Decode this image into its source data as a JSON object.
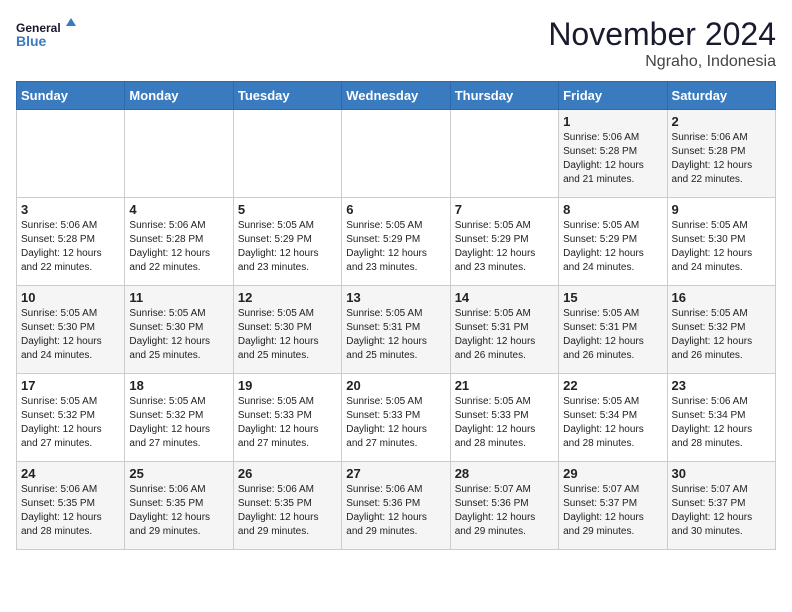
{
  "header": {
    "logo_line1": "General",
    "logo_line2": "Blue",
    "month": "November 2024",
    "location": "Ngraho, Indonesia"
  },
  "days_of_week": [
    "Sunday",
    "Monday",
    "Tuesday",
    "Wednesday",
    "Thursday",
    "Friday",
    "Saturday"
  ],
  "weeks": [
    [
      {
        "day": "",
        "info": ""
      },
      {
        "day": "",
        "info": ""
      },
      {
        "day": "",
        "info": ""
      },
      {
        "day": "",
        "info": ""
      },
      {
        "day": "",
        "info": ""
      },
      {
        "day": "1",
        "info": "Sunrise: 5:06 AM\nSunset: 5:28 PM\nDaylight: 12 hours\nand 21 minutes."
      },
      {
        "day": "2",
        "info": "Sunrise: 5:06 AM\nSunset: 5:28 PM\nDaylight: 12 hours\nand 22 minutes."
      }
    ],
    [
      {
        "day": "3",
        "info": "Sunrise: 5:06 AM\nSunset: 5:28 PM\nDaylight: 12 hours\nand 22 minutes."
      },
      {
        "day": "4",
        "info": "Sunrise: 5:06 AM\nSunset: 5:28 PM\nDaylight: 12 hours\nand 22 minutes."
      },
      {
        "day": "5",
        "info": "Sunrise: 5:05 AM\nSunset: 5:29 PM\nDaylight: 12 hours\nand 23 minutes."
      },
      {
        "day": "6",
        "info": "Sunrise: 5:05 AM\nSunset: 5:29 PM\nDaylight: 12 hours\nand 23 minutes."
      },
      {
        "day": "7",
        "info": "Sunrise: 5:05 AM\nSunset: 5:29 PM\nDaylight: 12 hours\nand 23 minutes."
      },
      {
        "day": "8",
        "info": "Sunrise: 5:05 AM\nSunset: 5:29 PM\nDaylight: 12 hours\nand 24 minutes."
      },
      {
        "day": "9",
        "info": "Sunrise: 5:05 AM\nSunset: 5:30 PM\nDaylight: 12 hours\nand 24 minutes."
      }
    ],
    [
      {
        "day": "10",
        "info": "Sunrise: 5:05 AM\nSunset: 5:30 PM\nDaylight: 12 hours\nand 24 minutes."
      },
      {
        "day": "11",
        "info": "Sunrise: 5:05 AM\nSunset: 5:30 PM\nDaylight: 12 hours\nand 25 minutes."
      },
      {
        "day": "12",
        "info": "Sunrise: 5:05 AM\nSunset: 5:30 PM\nDaylight: 12 hours\nand 25 minutes."
      },
      {
        "day": "13",
        "info": "Sunrise: 5:05 AM\nSunset: 5:31 PM\nDaylight: 12 hours\nand 25 minutes."
      },
      {
        "day": "14",
        "info": "Sunrise: 5:05 AM\nSunset: 5:31 PM\nDaylight: 12 hours\nand 26 minutes."
      },
      {
        "day": "15",
        "info": "Sunrise: 5:05 AM\nSunset: 5:31 PM\nDaylight: 12 hours\nand 26 minutes."
      },
      {
        "day": "16",
        "info": "Sunrise: 5:05 AM\nSunset: 5:32 PM\nDaylight: 12 hours\nand 26 minutes."
      }
    ],
    [
      {
        "day": "17",
        "info": "Sunrise: 5:05 AM\nSunset: 5:32 PM\nDaylight: 12 hours\nand 27 minutes."
      },
      {
        "day": "18",
        "info": "Sunrise: 5:05 AM\nSunset: 5:32 PM\nDaylight: 12 hours\nand 27 minutes."
      },
      {
        "day": "19",
        "info": "Sunrise: 5:05 AM\nSunset: 5:33 PM\nDaylight: 12 hours\nand 27 minutes."
      },
      {
        "day": "20",
        "info": "Sunrise: 5:05 AM\nSunset: 5:33 PM\nDaylight: 12 hours\nand 27 minutes."
      },
      {
        "day": "21",
        "info": "Sunrise: 5:05 AM\nSunset: 5:33 PM\nDaylight: 12 hours\nand 28 minutes."
      },
      {
        "day": "22",
        "info": "Sunrise: 5:05 AM\nSunset: 5:34 PM\nDaylight: 12 hours\nand 28 minutes."
      },
      {
        "day": "23",
        "info": "Sunrise: 5:06 AM\nSunset: 5:34 PM\nDaylight: 12 hours\nand 28 minutes."
      }
    ],
    [
      {
        "day": "24",
        "info": "Sunrise: 5:06 AM\nSunset: 5:35 PM\nDaylight: 12 hours\nand 28 minutes."
      },
      {
        "day": "25",
        "info": "Sunrise: 5:06 AM\nSunset: 5:35 PM\nDaylight: 12 hours\nand 29 minutes."
      },
      {
        "day": "26",
        "info": "Sunrise: 5:06 AM\nSunset: 5:35 PM\nDaylight: 12 hours\nand 29 minutes."
      },
      {
        "day": "27",
        "info": "Sunrise: 5:06 AM\nSunset: 5:36 PM\nDaylight: 12 hours\nand 29 minutes."
      },
      {
        "day": "28",
        "info": "Sunrise: 5:07 AM\nSunset: 5:36 PM\nDaylight: 12 hours\nand 29 minutes."
      },
      {
        "day": "29",
        "info": "Sunrise: 5:07 AM\nSunset: 5:37 PM\nDaylight: 12 hours\nand 29 minutes."
      },
      {
        "day": "30",
        "info": "Sunrise: 5:07 AM\nSunset: 5:37 PM\nDaylight: 12 hours\nand 30 minutes."
      }
    ]
  ]
}
